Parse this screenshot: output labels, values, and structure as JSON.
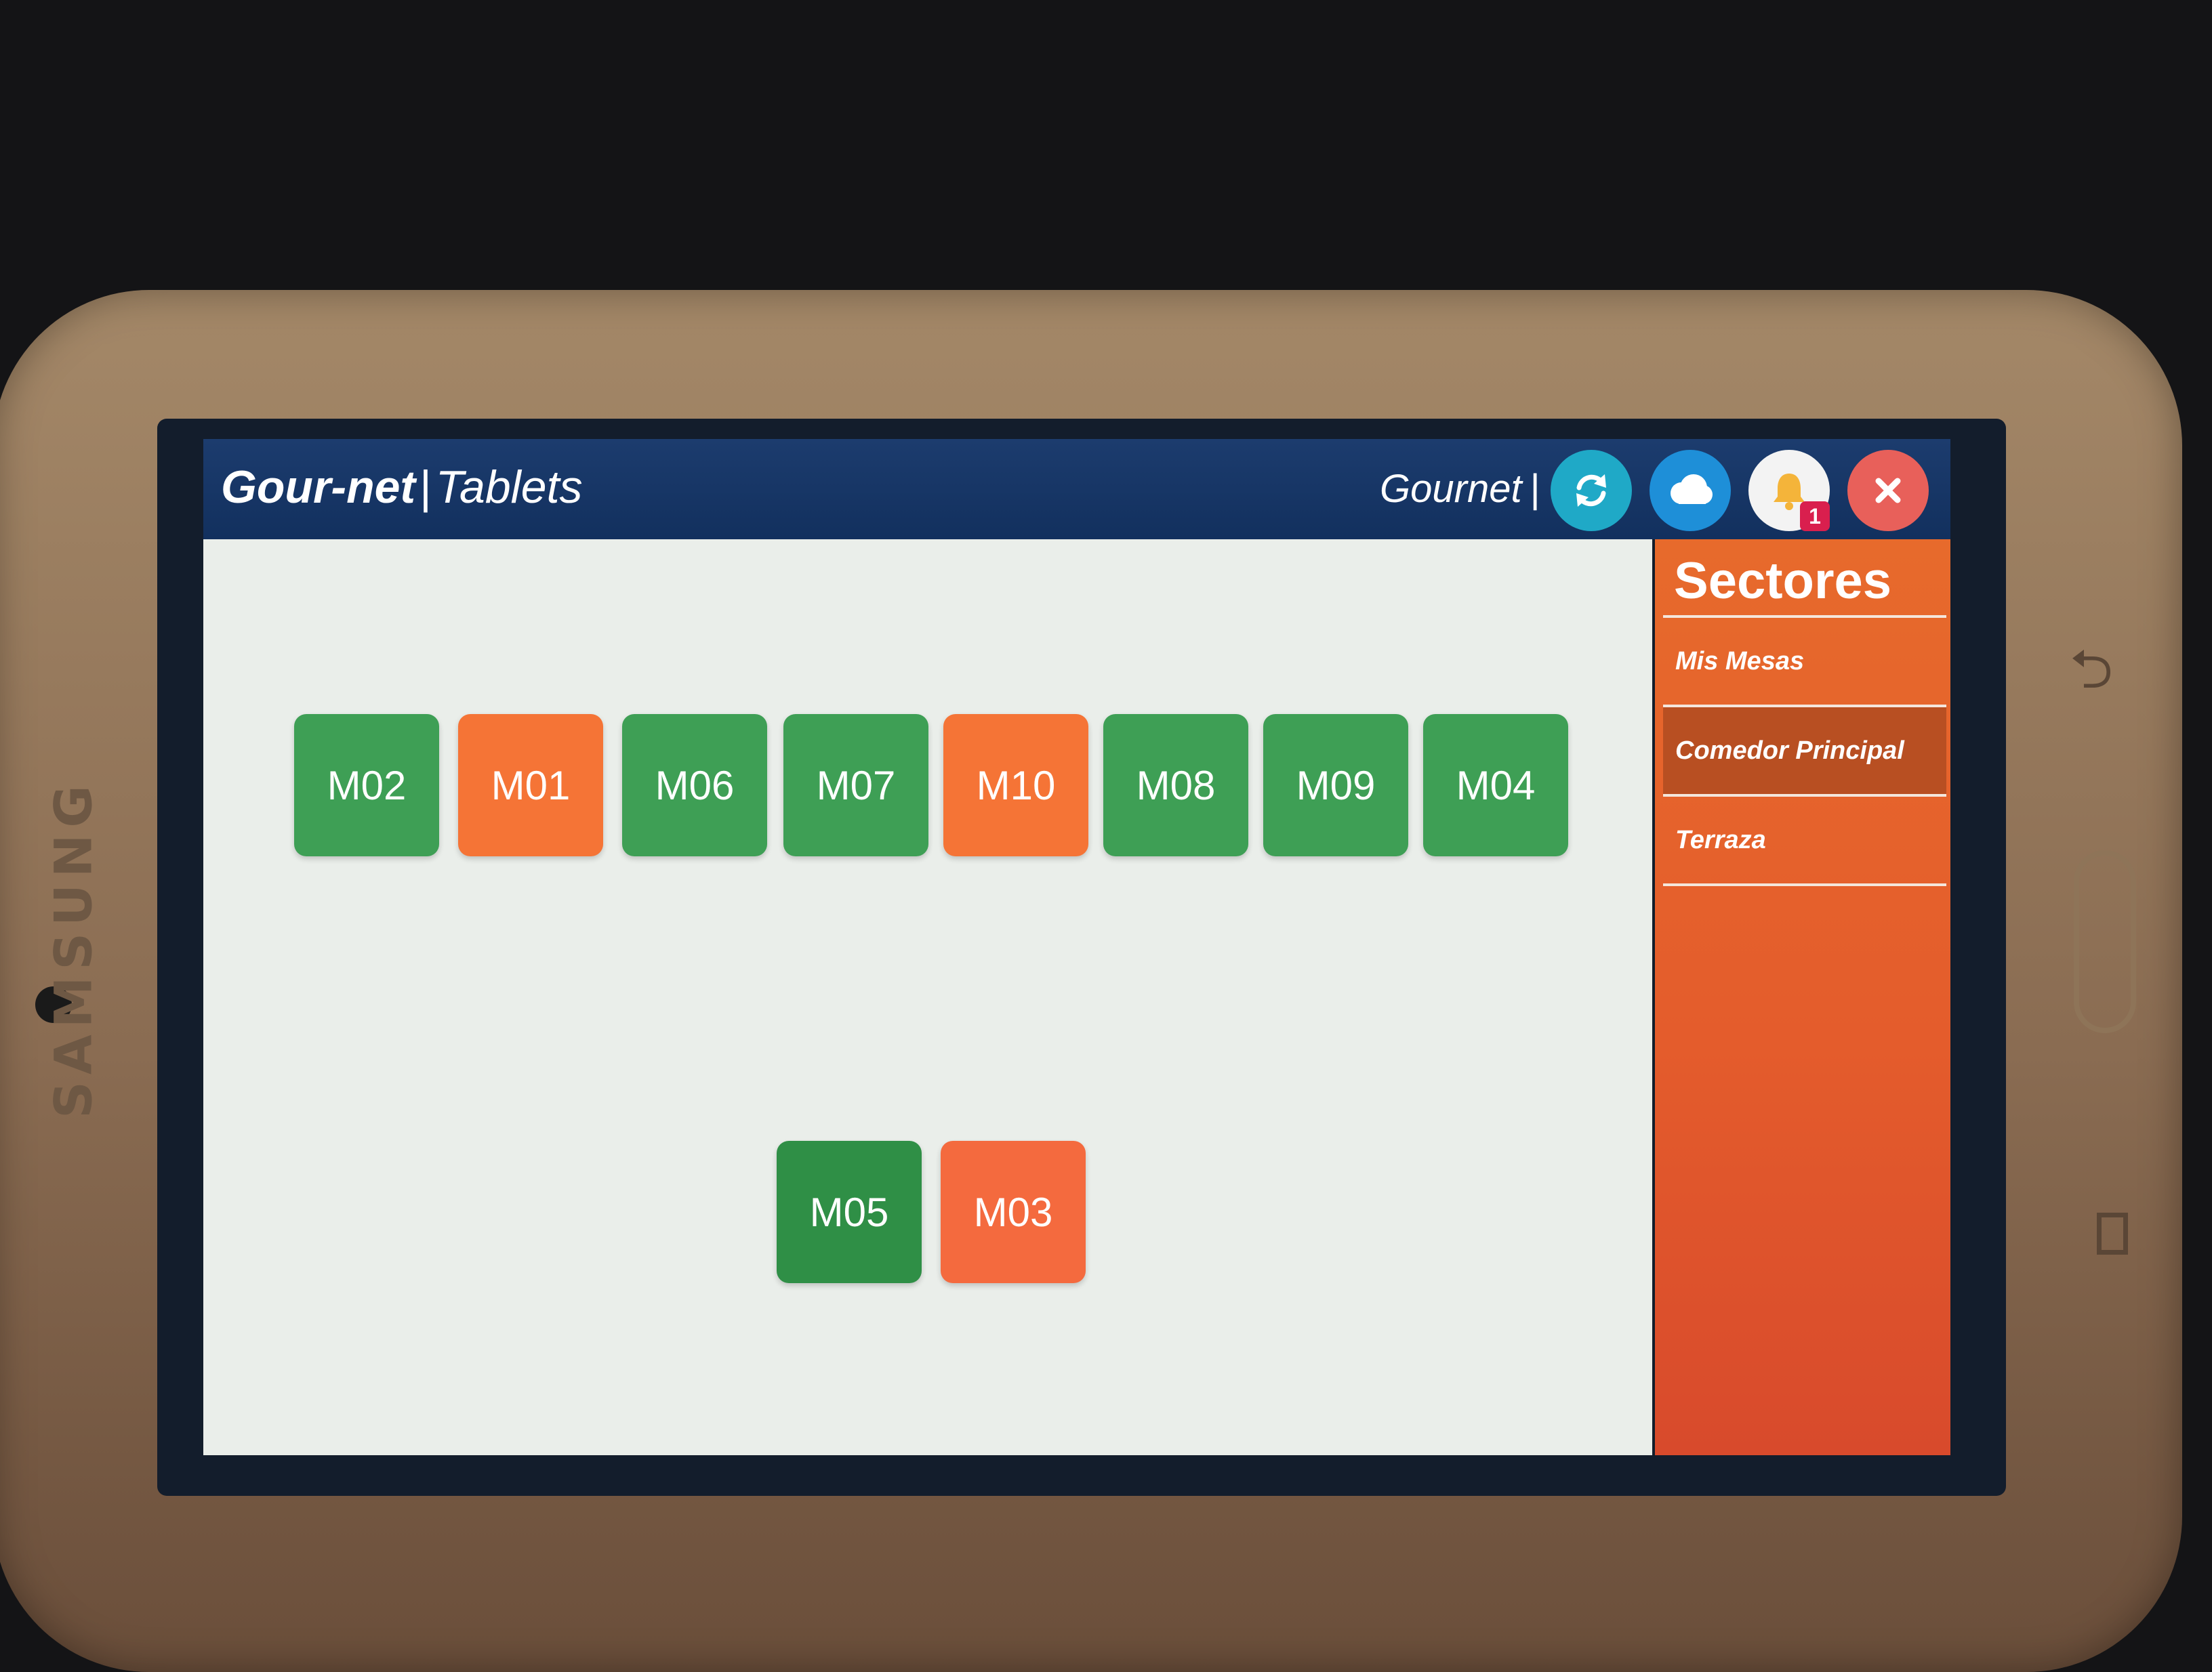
{
  "device": {
    "brand": "SAMSUNG"
  },
  "header": {
    "logo_brand": "Gour-net",
    "logo_separator": "|",
    "logo_product": "Tablets",
    "user_name": "Gournet",
    "user_separator": "|",
    "notification_count": "1",
    "buttons": [
      {
        "name": "refresh",
        "icon": "refresh-icon",
        "color": "#1fa9c7"
      },
      {
        "name": "cloud",
        "icon": "cloud-icon",
        "color": "#1e8fd8"
      },
      {
        "name": "notifications",
        "icon": "bell-icon",
        "color": "#f3f3f3"
      },
      {
        "name": "close",
        "icon": "close-icon",
        "color": "#e8605a"
      }
    ]
  },
  "tables": {
    "row1": [
      "M02",
      "M01",
      "M06",
      "M07",
      "M10",
      "M08",
      "M09",
      "M04"
    ],
    "row2": [
      "M05",
      "M03"
    ],
    "status_colors": {
      "free": "#3e9f55",
      "occupied": "#f57436"
    }
  },
  "sidebar": {
    "title": "Sectores",
    "items": [
      {
        "label": "Mis Mesas",
        "active": false
      },
      {
        "label": "Comedor Principal",
        "active": true
      },
      {
        "label": "Terraza",
        "active": false
      }
    ]
  }
}
